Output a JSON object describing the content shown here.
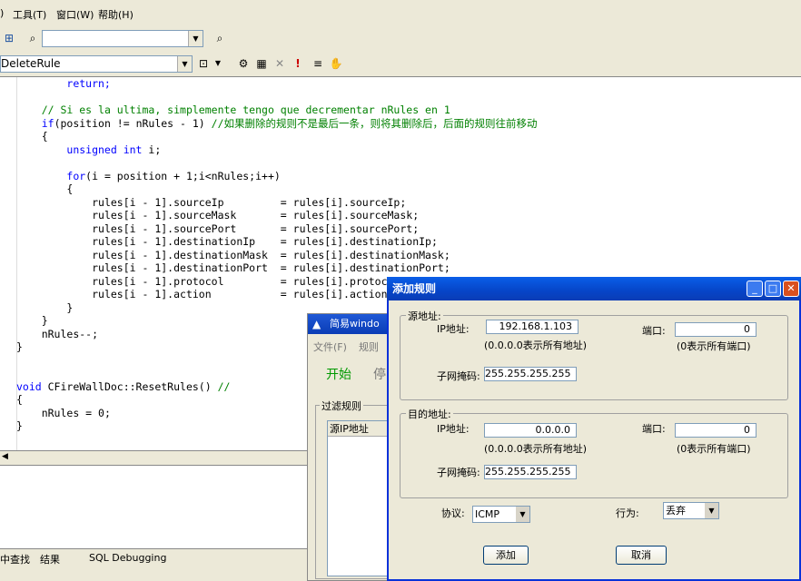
{
  "menu": {
    "items": [
      ") ",
      "工具(T)",
      "窗口(W)",
      "帮助(H)"
    ]
  },
  "toolbar": {
    "function_combo_value": "DeleteRule",
    "search_combo_value": ""
  },
  "code": {
    "lines": [
      {
        "indent": "        ",
        "text": "return;",
        "type": "kw"
      },
      {
        "indent": "",
        "text": "",
        "type": "plain"
      },
      {
        "indent": "    ",
        "text": "// Si es la ultima, simplemente tengo que decrementar nRules en 1",
        "type": "cm"
      },
      {
        "indent": "    ",
        "text": "if(position != nRules - 1) //如果删除的规则不是最后一条，则将其删除后，后面的规则往前移动",
        "type": "mixed"
      },
      {
        "indent": "    ",
        "text": "{",
        "type": "plain"
      },
      {
        "indent": "        ",
        "text": "unsigned int i;",
        "type": "kw2"
      },
      {
        "indent": "",
        "text": "",
        "type": "plain"
      },
      {
        "indent": "        ",
        "text": "for(i = position + 1;i<nRules;i++)",
        "type": "for"
      },
      {
        "indent": "        ",
        "text": "{",
        "type": "plain"
      },
      {
        "indent": "            ",
        "text": "rules[i - 1].sourceIp         = rules[i].sourceIp;",
        "type": "plain"
      },
      {
        "indent": "            ",
        "text": "rules[i - 1].sourceMask       = rules[i].sourceMask;",
        "type": "plain"
      },
      {
        "indent": "            ",
        "text": "rules[i - 1].sourcePort       = rules[i].sourcePort;",
        "type": "plain"
      },
      {
        "indent": "            ",
        "text": "rules[i - 1].destinationIp    = rules[i].destinationIp;",
        "type": "plain"
      },
      {
        "indent": "            ",
        "text": "rules[i - 1].destinationMask  = rules[i].destinationMask;",
        "type": "plain"
      },
      {
        "indent": "            ",
        "text": "rules[i - 1].destinationPort  = rules[i].destinationPort;",
        "type": "plain"
      },
      {
        "indent": "            ",
        "text": "rules[i - 1].protocol         = rules[i].protocol;",
        "type": "plain"
      },
      {
        "indent": "            ",
        "text": "rules[i - 1].action           = rules[i].action;",
        "type": "plain"
      },
      {
        "indent": "        ",
        "text": "}",
        "type": "plain"
      },
      {
        "indent": "    ",
        "text": "}",
        "type": "plain"
      },
      {
        "indent": "    ",
        "text": "nRules--;",
        "type": "plain"
      },
      {
        "indent": "",
        "text": "}",
        "type": "plain"
      },
      {
        "indent": "",
        "text": "",
        "type": "plain"
      },
      {
        "indent": "",
        "text": "",
        "type": "plain"
      },
      {
        "indent": "",
        "text": "void CFireWallDoc::ResetRules() //",
        "type": "void"
      },
      {
        "indent": "",
        "text": "{",
        "type": "plain"
      },
      {
        "indent": "    ",
        "text": "nRules = 0;",
        "type": "plain"
      },
      {
        "indent": "",
        "text": "}",
        "type": "plain"
      }
    ]
  },
  "output_tabs": [
    "中查找",
    "结果",
    "SQL Debugging"
  ],
  "bg_window": {
    "title": "简易windo",
    "menu": [
      "文件(F)",
      "规则"
    ],
    "start_label": "开始",
    "stop_label": "停",
    "filter_group": "过滤规则",
    "col_header": "源IP地址"
  },
  "dialog": {
    "title": "添加规则",
    "source": {
      "group_label": "源地址:",
      "ip_label": "IP地址:",
      "ip_value": "192.168.1.103",
      "ip_hint": "(0.0.0.0表示所有地址)",
      "port_label": "端口:",
      "port_value": "0",
      "port_hint": "(0表示所有端口)",
      "mask_label": "子网掩码:",
      "mask_value": "255.255.255.255"
    },
    "destination": {
      "group_label": "目的地址:",
      "ip_label": "IP地址:",
      "ip_value": "0.0.0.0",
      "ip_hint": "(0.0.0.0表示所有地址)",
      "port_label": "端口:",
      "port_value": "0",
      "port_hint": "(0表示所有端口)",
      "mask_label": "子网掩码:",
      "mask_value": "255.255.255.255"
    },
    "protocol_label": "协议:",
    "protocol_value": "ICMP",
    "action_label": "行为:",
    "action_value": "丢弃",
    "add_label": "添加",
    "cancel_label": "取消"
  },
  "colors": {
    "keyword": "#0000ff",
    "comment": "#008000",
    "titlebar": "#0a5ee8"
  }
}
